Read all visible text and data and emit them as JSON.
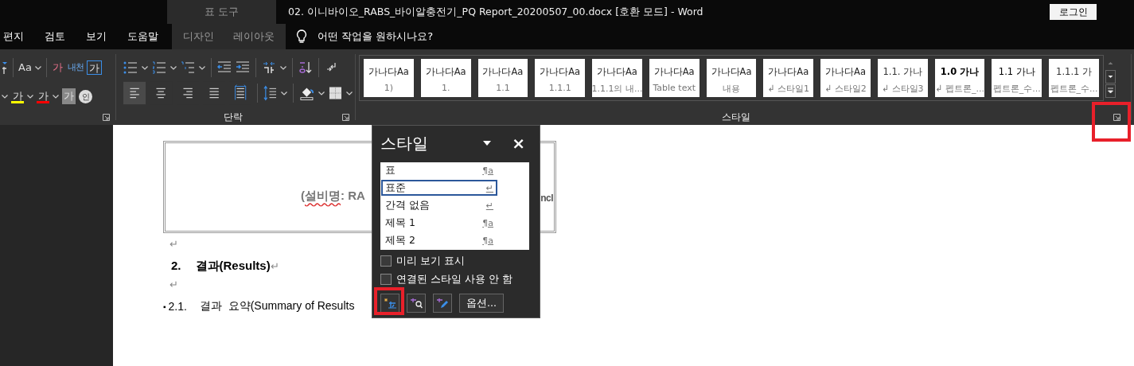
{
  "title_bar": {
    "context_label": "표 도구",
    "document_title": "02. 이니바이오_RABS_바이알충전기_PQ Report_20200507_00.docx [호환 모드]  -  Word",
    "login_button": "로그인"
  },
  "tabs": [
    {
      "label": "편지",
      "kind": "main",
      "selected": false
    },
    {
      "label": "검토",
      "kind": "main",
      "selected": false
    },
    {
      "label": "보기",
      "kind": "main",
      "selected": false
    },
    {
      "label": "도움말",
      "kind": "main",
      "selected": false
    },
    {
      "label": "디자인",
      "kind": "context",
      "selected": false
    },
    {
      "label": "레이아웃",
      "kind": "context",
      "selected": false
    }
  ],
  "tell_me": {
    "label": "어떤 작업을 원하시나요?"
  },
  "font_group": {
    "top_row": [
      {
        "glyph": "Aa",
        "kind": "case"
      },
      {
        "glyph": "가",
        "kind": "clear"
      },
      {
        "glyph": "내천",
        "kind": "phonetic"
      },
      {
        "glyph": "가",
        "kind": "boxed"
      }
    ],
    "bottom_row": [
      {
        "glyph": "가",
        "kind": "highlight",
        "color": "#ffff00"
      },
      {
        "glyph": "가",
        "kind": "font_color",
        "color": "#ff0000"
      },
      {
        "glyph": "가",
        "kind": "shaded"
      },
      {
        "glyph": "인",
        "kind": "circled"
      }
    ]
  },
  "paragraph_group": {
    "label": "단락",
    "alignments": [
      {
        "kind": "left",
        "selected": true
      },
      {
        "kind": "center",
        "selected": false
      },
      {
        "kind": "right",
        "selected": false
      },
      {
        "kind": "justify",
        "selected": false
      },
      {
        "kind": "distributed",
        "selected": false
      }
    ]
  },
  "styles_group": {
    "label": "스타일",
    "launcher_highlighted": true,
    "gallery": [
      {
        "preview": "가나다Aa",
        "name": "1)",
        "kind": "plain"
      },
      {
        "preview": "가나다Aa",
        "name": "1.",
        "kind": "plain"
      },
      {
        "preview": "가나다Aa",
        "name": "1.1",
        "kind": "plain"
      },
      {
        "preview": "가나다Aa",
        "name": "1.1.1",
        "kind": "plain"
      },
      {
        "preview": "가나다Aa",
        "name": "1.1.1의 내...",
        "kind": "plain"
      },
      {
        "preview": "가나다Aa",
        "name": "Table text",
        "kind": "plain"
      },
      {
        "preview": "가나다Aa",
        "name": "내용",
        "kind": "plain"
      },
      {
        "preview": "가나다Aa",
        "name": "↲ 스타일1",
        "kind": "plain"
      },
      {
        "preview": "가나다Aa",
        "name": "↲ 스타일2",
        "kind": "plain"
      },
      {
        "preview": "1.1.  가나",
        "name": "↲ 스타일3",
        "kind": "numbered"
      },
      {
        "preview": "1.0  가나",
        "name": "↲ 펩트론_...",
        "kind": "bold"
      },
      {
        "preview": "1.1  가나",
        "name": "펩트론_수...",
        "kind": "bold_number"
      },
      {
        "preview": "1.1.1  가",
        "name": "펩트론_수...",
        "kind": "numbered"
      }
    ]
  },
  "document": {
    "box_line": {
      "before": "(",
      "misspelled": "설비명",
      "after": ": RA"
    },
    "box_right_fragment": "ncl",
    "paragraphs": [
      {
        "kind": "mark",
        "text": "↵"
      },
      {
        "kind": "heading",
        "number": "2.",
        "text": "결과(Results)",
        "mark": "↵"
      },
      {
        "kind": "mark",
        "text": "↵"
      },
      {
        "kind": "list",
        "bullet": "▪",
        "number": "2.1.",
        "text": "결과  요약(Summary of Results"
      }
    ]
  },
  "styles_pane": {
    "title": "스타일",
    "close": "×",
    "items": [
      {
        "name": "표",
        "mark": "¶a",
        "selected": false
      },
      {
        "name": "표준",
        "mark": "↵",
        "selected": true
      },
      {
        "name": "간격 없음",
        "mark": "↵",
        "selected": false
      },
      {
        "name": "제목 1",
        "mark": "¶a",
        "selected": false
      },
      {
        "name": "제목 2",
        "mark": "¶a",
        "selected": false
      }
    ],
    "checkboxes": [
      {
        "label": "미리 보기 표시",
        "checked": false
      },
      {
        "label": "연결된 스타일 사용 안 함",
        "checked": false
      }
    ],
    "buttons": [
      {
        "kind": "new_style",
        "highlighted": true
      },
      {
        "kind": "inspect",
        "highlighted": false
      },
      {
        "kind": "manage",
        "highlighted": false
      },
      {
        "kind": "text",
        "label": "옵션...",
        "highlighted": false
      }
    ]
  }
}
